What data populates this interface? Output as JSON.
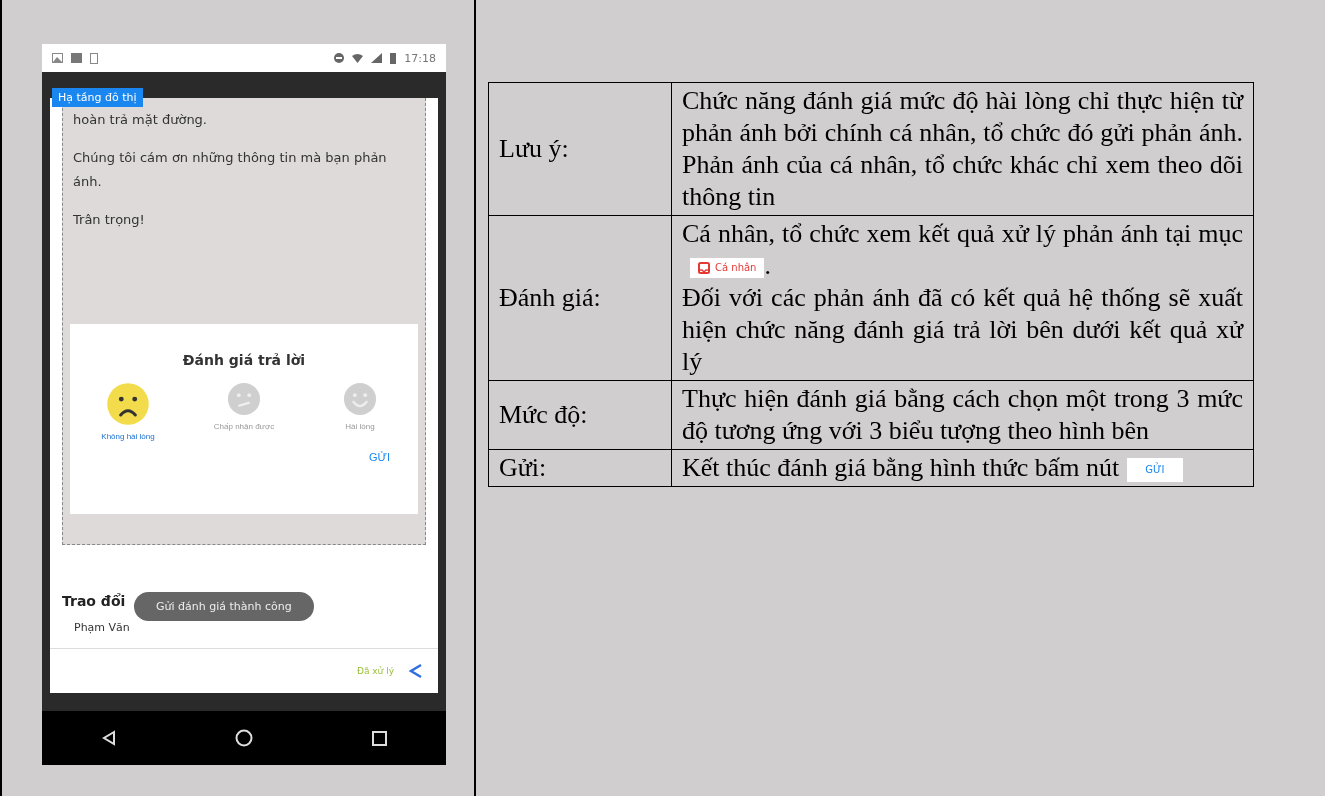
{
  "phone": {
    "status_bar": {
      "time": "17:18"
    },
    "category_tag": "Hạ tầng đô thị",
    "message": [
      "hoàn trả mặt đường.",
      "Chúng tôi cám ơn những thông tin mà bạn phản ánh.",
      "Trân trọng!"
    ],
    "rating_dialog": {
      "title": "Đánh giá trả lời",
      "options": [
        {
          "kind": "sad",
          "label": "Không hài lòng",
          "selected": true
        },
        {
          "kind": "neutral",
          "label": "Chấp nhận được",
          "selected": false
        },
        {
          "kind": "happy",
          "label": "Hài lòng",
          "selected": false
        }
      ],
      "send_button": "GỬI"
    },
    "discussion_heading": "Trao đổi",
    "commenter": "Phạm Văn",
    "toast": "Gửi đánh giá thành công",
    "status": "Đã xử lý"
  },
  "table": {
    "rows": [
      {
        "label": "Lưu ý:",
        "parts": [
          {
            "kind": "text",
            "text": "Chức năng đánh giá mức độ hài lòng chỉ thực hiện từ phản ánh bởi chính cá nhân, tổ chức đó gửi phản ánh. Phản ánh của cá nhân, tổ chức khác chỉ xem theo dõi thông tin"
          }
        ]
      },
      {
        "label": "Đánh giá:",
        "parts": [
          {
            "kind": "text",
            "text": "Cá nhân, tổ chức xem kết quả xử lý phản ánh tại mục"
          },
          {
            "kind": "tab_chip",
            "text": "Cá nhân"
          },
          {
            "kind": "text",
            "text": "."
          },
          {
            "kind": "break"
          },
          {
            "kind": "text",
            "text": "Đối với các phản ánh đã có kết quả hệ thống sẽ xuất hiện chức năng đánh giá trả lời bên dưới kết quả xử lý"
          }
        ]
      },
      {
        "label": "Mức độ:",
        "parts": [
          {
            "kind": "text",
            "text": "Thực hiện đánh giá bằng cách chọn một trong 3 mức độ tương ứng với 3 biểu tượng theo hình bên"
          }
        ]
      },
      {
        "label": "Gửi:",
        "parts": [
          {
            "kind": "text",
            "text": "Kết thúc đánh giá bằng hình thức bấm nút"
          },
          {
            "kind": "button_chip",
            "text": "GỬI"
          }
        ]
      }
    ]
  }
}
